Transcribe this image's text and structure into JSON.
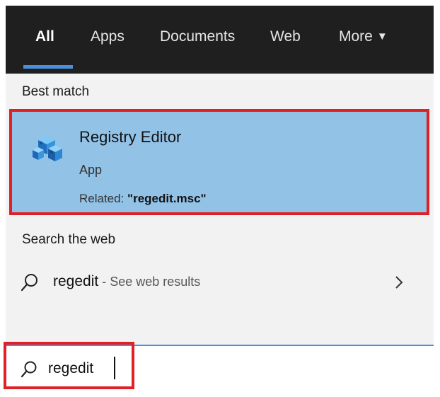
{
  "tabs": [
    {
      "label": "All",
      "active": true
    },
    {
      "label": "Apps"
    },
    {
      "label": "Documents"
    },
    {
      "label": "Web"
    },
    {
      "label": "More"
    }
  ],
  "best_match": {
    "section_label": "Best match",
    "title": "Registry Editor",
    "type": "App",
    "related_prefix": "Related: ",
    "related_value": "\"regedit.msc\"",
    "icon": "registry-cube-icon"
  },
  "web": {
    "section_label": "Search the web",
    "query": "regedit",
    "suffix": " - See web results"
  },
  "search": {
    "value": "regedit"
  },
  "colors": {
    "accent": "#4a8fe0",
    "highlight": "#e02027",
    "selected_bg": "#93c2e7",
    "tabbar_bg": "#1f1f1f"
  }
}
